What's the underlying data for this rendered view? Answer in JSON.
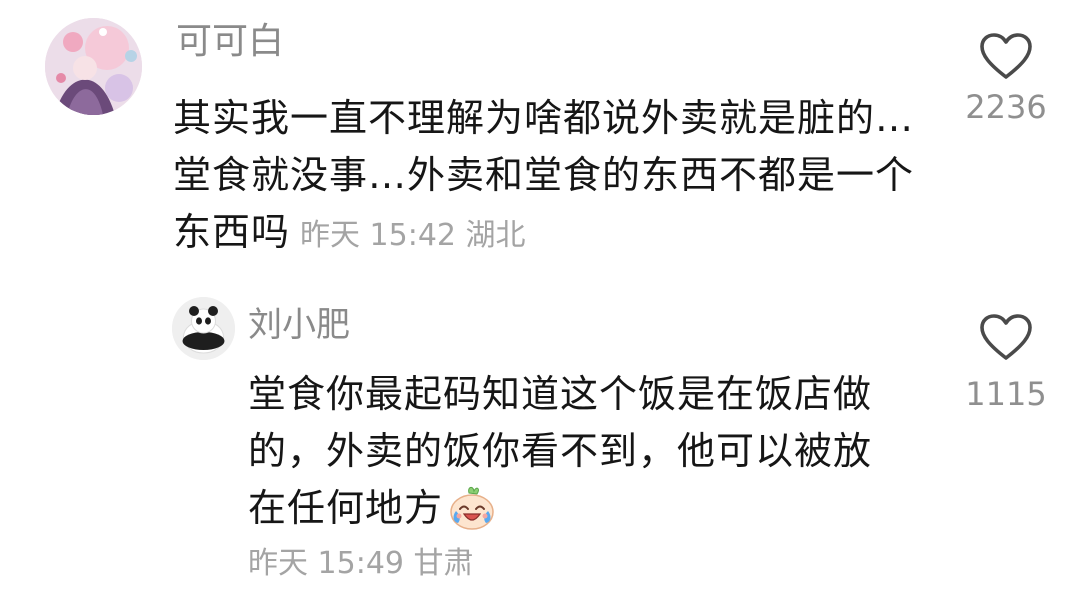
{
  "comments": [
    {
      "username": "可可白",
      "text": "其实我一直不理解为啥都说外卖就是脏的…堂食就没事…外卖和堂食的东西不都是一个东西吗",
      "meta": "昨天 15:42 湖北",
      "likes": "2236"
    },
    {
      "username": "刘小肥",
      "text": "堂食你最起码知道这个饭是在饭店做的，外卖的饭你看不到，他可以被放在任何地方",
      "meta": "昨天 15:49 甘肃",
      "likes": "1115",
      "emoji": "crying-laughing-emoji"
    }
  ],
  "icons": {
    "like": "heart-outline-icon"
  },
  "colors": {
    "text": "#161616",
    "username": "#8a8a8a",
    "meta": "#a4a4a4",
    "like_count": "#8f8f8f"
  }
}
